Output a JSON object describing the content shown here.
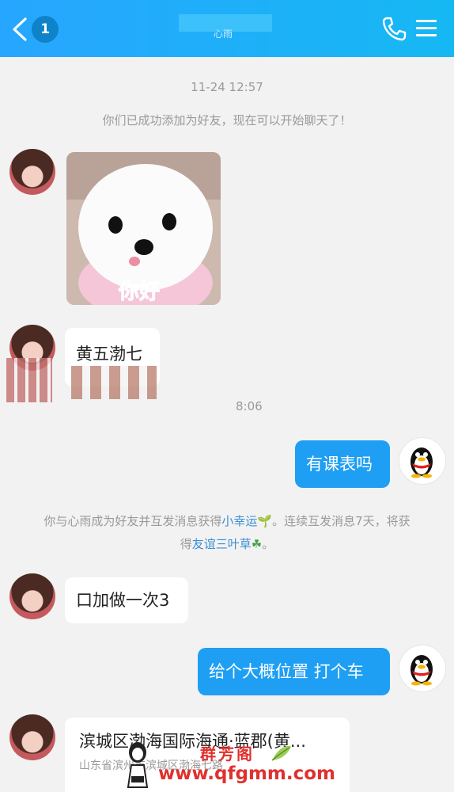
{
  "header": {
    "unread_count": "1",
    "title": "心雨"
  },
  "messages": {
    "timestamp_1": "11-24 12:57",
    "system_added": "你们已成功添加为好友，现在可以开始聊天了！",
    "sticker_caption": "你好",
    "partial_text": "黄五渤七",
    "partial_time": "8:06",
    "sent_timetable": "有课表吗",
    "system_lucky_a": "你与心雨成为好友并互发消息获得",
    "system_lucky_link1": "小幸运",
    "system_lucky_b": "。连续互发消息7天，将获",
    "system_lucky_c": "得",
    "system_lucky_link2": "友谊三叶草",
    "system_lucky_d": "。",
    "received_once": "口加做一次3",
    "sent_location_req": "给个大概位置 打个车",
    "location_title": "滨城区渤海国际海通·蓝郡(黄...",
    "location_address": "山东省滨州市滨城区渤海七路"
  },
  "watermark": {
    "name": "群芳阁",
    "url": "www.qfgmm.com"
  },
  "colors": {
    "header": "#1eaffb",
    "bubble_out": "#1e9ff3",
    "link": "#3b8fd6",
    "watermark": "#e0302e"
  },
  "icons": [
    "back-arrow-icon",
    "phone-icon",
    "menu-icon",
    "sprout-icon",
    "clover-icon",
    "qq-penguin-icon"
  ]
}
